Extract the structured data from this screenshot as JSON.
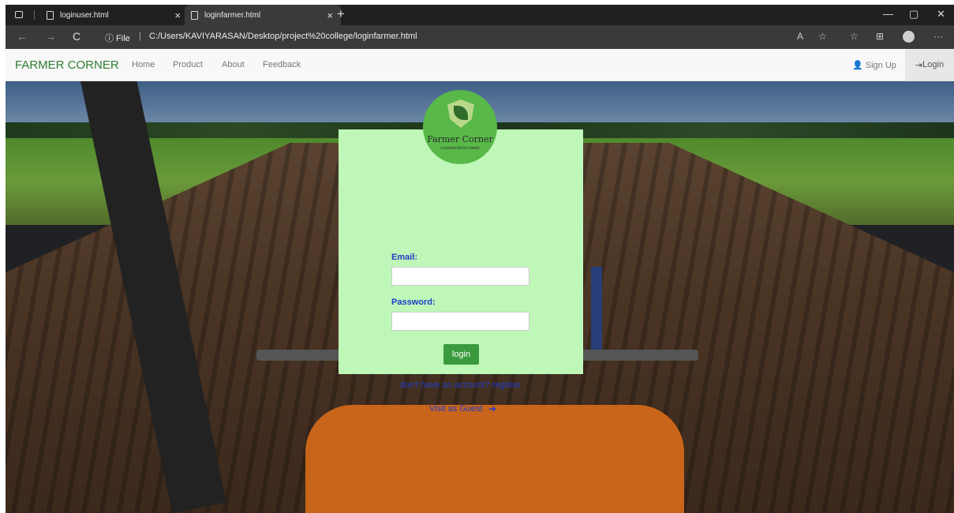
{
  "browser": {
    "tabs": [
      {
        "title": "loginuser.html",
        "close": "×"
      },
      {
        "title": "loginfarmer.html",
        "close": "×"
      }
    ],
    "new_tab": "+",
    "window_controls": {
      "minimize": "—",
      "restore": "▢",
      "close": "✕"
    },
    "nav": {
      "back": "←",
      "forward": "→",
      "reload": "C"
    },
    "address_info": "ⓘ File",
    "address_sep": "|",
    "url": "C:/Users/KAVIYARASAN/Desktop/project%20college/loginfarmer.html",
    "toolbar": {
      "read_aloud": "A",
      "fav": "☆",
      "collections": "⊞",
      "more": "···"
    }
  },
  "site": {
    "brand": "FARMER CORNER",
    "nav_links": [
      "Home",
      "Product",
      "About",
      "Feedback"
    ],
    "signup": "Sign Up",
    "login": "Login",
    "logo_text": "Farmer Corner",
    "logo_subtext": "a trusted farmer family"
  },
  "form": {
    "email_label": "Email:",
    "password_label": "Password:",
    "login_button": "login",
    "register_link": "don't have an account? register",
    "guest_link": "Visit as Guest",
    "guest_arrow": "➜"
  },
  "colors": {
    "brand": "#2e7d32",
    "card": "#bff7b8",
    "link": "#1f3cc8",
    "button": "#3a9a3e"
  }
}
